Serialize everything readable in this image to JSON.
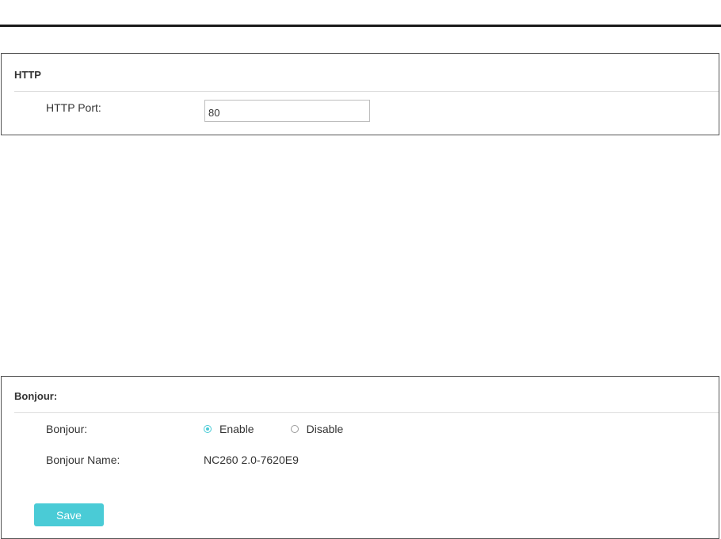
{
  "http_section": {
    "title": "HTTP",
    "port_label": "HTTP Port:",
    "port_value": "80"
  },
  "bonjour_section": {
    "title": "Bonjour:",
    "bonjour_label": "Bonjour:",
    "options": [
      {
        "label": "Enable",
        "selected": true
      },
      {
        "label": "Disable",
        "selected": false
      }
    ],
    "name_label": "Bonjour Name:",
    "name_value": "NC260 2.0-7620E9",
    "save_label": "Save"
  },
  "colors": {
    "accent": "#4acbd6",
    "border": "#555555",
    "text": "#333333"
  }
}
